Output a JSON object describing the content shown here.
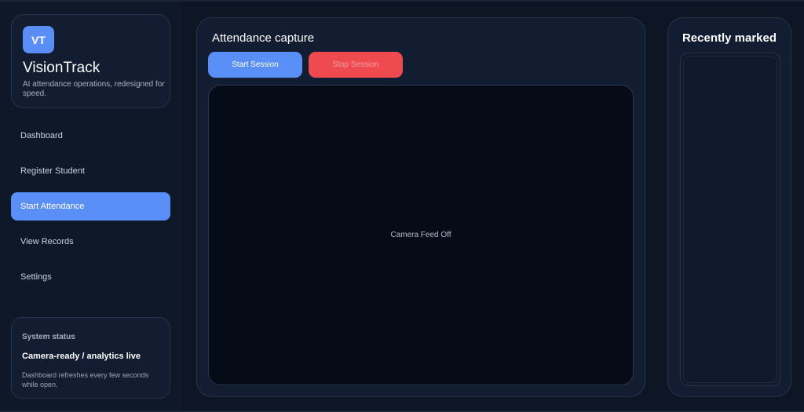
{
  "brand": {
    "logo_text": "VT",
    "name": "VisionTrack",
    "tagline": "AI attendance operations, redesigned for speed."
  },
  "nav": {
    "items": [
      {
        "label": "Dashboard"
      },
      {
        "label": "Register Student"
      },
      {
        "label": "Start Attendance"
      },
      {
        "label": "View Records"
      },
      {
        "label": "Settings"
      }
    ],
    "active": "Start Attendance"
  },
  "status": {
    "title": "System status",
    "value": "Camera-ready / analytics live",
    "note": "Dashboard refreshes every few seconds while open."
  },
  "capture": {
    "title": "Attendance capture",
    "start_label": "Start Session",
    "stop_label": "Stop Session",
    "feed_text": "Camera Feed Off"
  },
  "recent": {
    "title": "Recently marked",
    "items": []
  },
  "colors": {
    "accent": "#5b8ff8",
    "danger": "#ef4a4f",
    "background": "#0e1626"
  }
}
